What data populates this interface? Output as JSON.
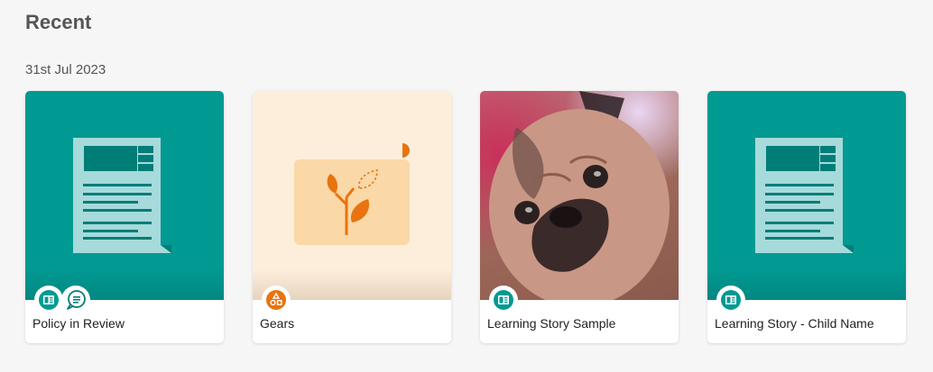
{
  "section": {
    "title": "Recent"
  },
  "date_group": {
    "label": "31st Jul 2023"
  },
  "cards": [
    {
      "title": "Policy in Review",
      "thumbnail": "document-illustration",
      "type_icons": [
        "document-icon",
        "reflection-icon"
      ]
    },
    {
      "title": "Gears",
      "thumbnail": "sprout-illustration",
      "type_icons": [
        "shapes-icon"
      ]
    },
    {
      "title": "Learning Story Sample",
      "thumbnail": "pug-photo",
      "type_icons": [
        "document-icon"
      ]
    },
    {
      "title": "Learning Story - Child Name",
      "thumbnail": "document-illustration",
      "type_icons": [
        "document-icon"
      ]
    }
  ],
  "colors": {
    "teal": "#019a93",
    "orange": "#e8730f",
    "peach": "#fdeedb"
  }
}
